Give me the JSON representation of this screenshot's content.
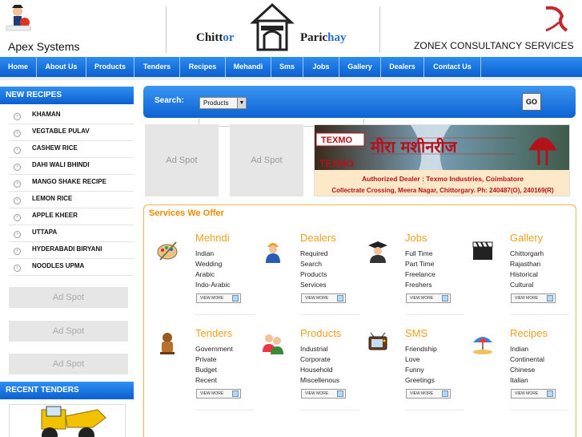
{
  "header": {
    "left_brand": "Apex Systems",
    "center_brand_part1": "Chitt",
    "center_brand_part1_hi": "or",
    "center_brand_part2": "Paric",
    "center_brand_part2_hi": "hay",
    "right_brand": "ZONEX CONSULTANCY SERVICES"
  },
  "nav": {
    "items": [
      "Home",
      "About Us",
      "Products",
      "Tenders",
      "Recipes",
      "Mehandi",
      "Sms",
      "Jobs",
      "Gallery",
      "Dealers",
      "Contact Us"
    ]
  },
  "sidebar": {
    "recipes_title": "NEW RECIPES",
    "recipes": [
      "KHAMAN",
      "VEGTABLE PULAV",
      "CASHEW RICE",
      "DAHI WALI BHINDI",
      "MANGO SHAKE RECIPE",
      "LEMON RICE",
      "APPLE KHEER",
      "UTTAPA",
      "HYDERABADI BIRYANI",
      "NOODLES UPMA"
    ],
    "ads": [
      "Ad Spot",
      "Ad Spot",
      "Ad Spot"
    ],
    "tenders_title": "RECENT TENDERS"
  },
  "search": {
    "label": "Search:",
    "selected": "Products",
    "go_label": "GO"
  },
  "ads": {
    "spot1": "Ad Spot",
    "spot2": "Ad Spot"
  },
  "banner": {
    "brand": "TEXMO",
    "line1": "Authorized Dealer : Texmo Industries, Coimbatore",
    "line2": "Collectrate Crossing, Meera Nagar, Chittorgary. Ph: 240487(O), 240169(R)",
    "colors": {
      "dark": "#b4121b",
      "light": "#fde9c8"
    }
  },
  "services": {
    "title": "Services We Offer",
    "view_more": "VIEW MORE",
    "items": [
      {
        "title": "Mehndi",
        "icon": "palette-icon",
        "lines": [
          "Indian",
          "Wedding",
          "Arabic",
          "Indo-Arabic"
        ]
      },
      {
        "title": "Dealers",
        "icon": "worker-icon",
        "lines": [
          "Required",
          "Search",
          "Products",
          "Services"
        ]
      },
      {
        "title": "Jobs",
        "icon": "graduate-icon",
        "lines": [
          "Full Time",
          "Part Time",
          "Freelance",
          "Freshers"
        ]
      },
      {
        "title": "Gallery",
        "icon": "clapperboard-icon",
        "lines": [
          "Chittorgarh",
          "Rajasthan",
          "Historical",
          "Cultural"
        ]
      },
      {
        "title": "Tenders",
        "icon": "figurine-icon",
        "lines": [
          "Government",
          "Private",
          "Budget",
          "Recent"
        ]
      },
      {
        "title": "Products",
        "icon": "people-icon",
        "lines": [
          "Industrial",
          "Corporate",
          "Household",
          "Miscellenous"
        ]
      },
      {
        "title": "SMS",
        "icon": "tv-icon",
        "lines": [
          "Friendship",
          "Love",
          "Funny",
          "Greetings"
        ]
      },
      {
        "title": "Recipes",
        "icon": "umbrella-icon",
        "lines": [
          "Indian",
          "Continental",
          "Chinese",
          "Italian"
        ]
      }
    ]
  }
}
